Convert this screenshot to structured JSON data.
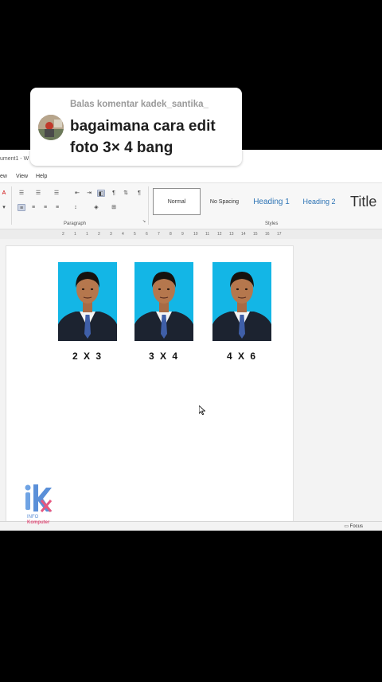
{
  "comment": {
    "reply_label": "Balas komentar kadek_santika_",
    "message": "bagaimana cara edit foto 3× 4 bang"
  },
  "word": {
    "title": "ument1 - W",
    "menu": [
      "ew",
      "View",
      "Help"
    ],
    "ribbon": {
      "styles": [
        "Normal",
        "No Spacing",
        "Heading 1",
        "Heading 2",
        "Title"
      ],
      "group_labels": [
        "Paragraph",
        "Styles"
      ]
    },
    "ruler_numbers": [
      "2",
      "1",
      "1",
      "2",
      "3",
      "4",
      "5",
      "6",
      "7",
      "8",
      "9",
      "10",
      "11",
      "12",
      "13",
      "14",
      "15",
      "16",
      "17"
    ],
    "photos": [
      {
        "label": "2 X 3"
      },
      {
        "label": "3 X 4"
      },
      {
        "label": "4 X 6"
      }
    ],
    "status": {
      "focus": "Focus"
    }
  },
  "logo": {
    "line1": "INFO",
    "line2": "Komputer"
  },
  "colors": {
    "photo_bg": "#13b6e6",
    "heading": "#2e74b5",
    "background": "#000000"
  }
}
